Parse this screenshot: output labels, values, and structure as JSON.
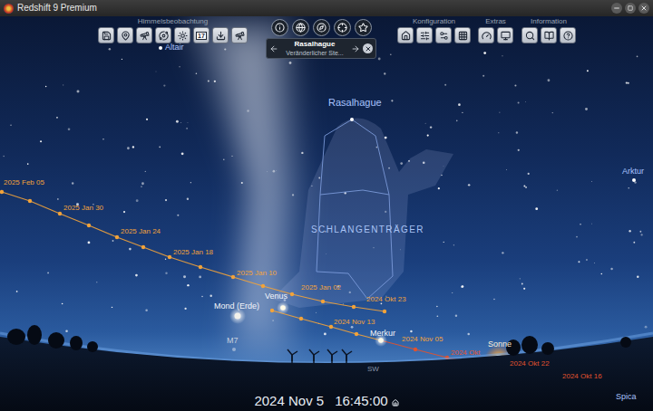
{
  "window": {
    "title": "Redshift 9 Premium"
  },
  "toolbar": {
    "groups": [
      {
        "label": "Himmelsbeobachtung",
        "calendar_day": "17"
      },
      {
        "label": "Konfiguration"
      },
      {
        "label": "Extras"
      },
      {
        "label": "Information"
      }
    ]
  },
  "info_panel": {
    "title": "Rasalhague",
    "subtitle": "Veränderlicher Ste..."
  },
  "sky": {
    "constellation": "SCHLANGENTRÄGER",
    "objects": [
      {
        "name": "Altair",
        "kind": "star"
      },
      {
        "name": "Rasalhague",
        "kind": "star"
      },
      {
        "name": "Arktur",
        "kind": "star"
      },
      {
        "name": "Spica",
        "kind": "star"
      },
      {
        "name": "Mond (Erde)",
        "kind": "moon"
      },
      {
        "name": "Venus",
        "kind": "planet"
      },
      {
        "name": "Merkur",
        "kind": "planet"
      },
      {
        "name": "Sonne",
        "kind": "sun"
      },
      {
        "name": "M7",
        "kind": "cluster"
      }
    ],
    "horizon": {
      "direction": "SW"
    }
  },
  "tracks": [
    {
      "planet": "Venus",
      "labels": [
        {
          "text": "2025 Feb 05",
          "color": "#f2a33a"
        },
        {
          "text": "2025 Jan 30",
          "color": "#f2a33a"
        },
        {
          "text": "2025 Jan 24",
          "color": "#f2a33a"
        },
        {
          "text": "2025 Jan 18",
          "color": "#f2a33a"
        },
        {
          "text": "2025 Jan 10",
          "color": "#f2a33a"
        },
        {
          "text": "2025 Jan 02",
          "color": "#f2a33a"
        },
        {
          "text": "2024 Okt 23",
          "color": "#f2a33a"
        }
      ]
    },
    {
      "planet": "Merkur",
      "labels": [
        {
          "text": "2024 Nov 13",
          "color": "#f2a33a"
        },
        {
          "text": "2024 Nov 05",
          "color": "#f2a33a"
        },
        {
          "text": "2024 Okt",
          "color": "#e0532f"
        },
        {
          "text": "2024 Okt 22",
          "color": "#e0532f"
        },
        {
          "text": "2024 Okt 16",
          "color": "#e0532f"
        }
      ]
    }
  ],
  "status": {
    "date": "2024 Nov 5",
    "time": "16:45:00"
  }
}
